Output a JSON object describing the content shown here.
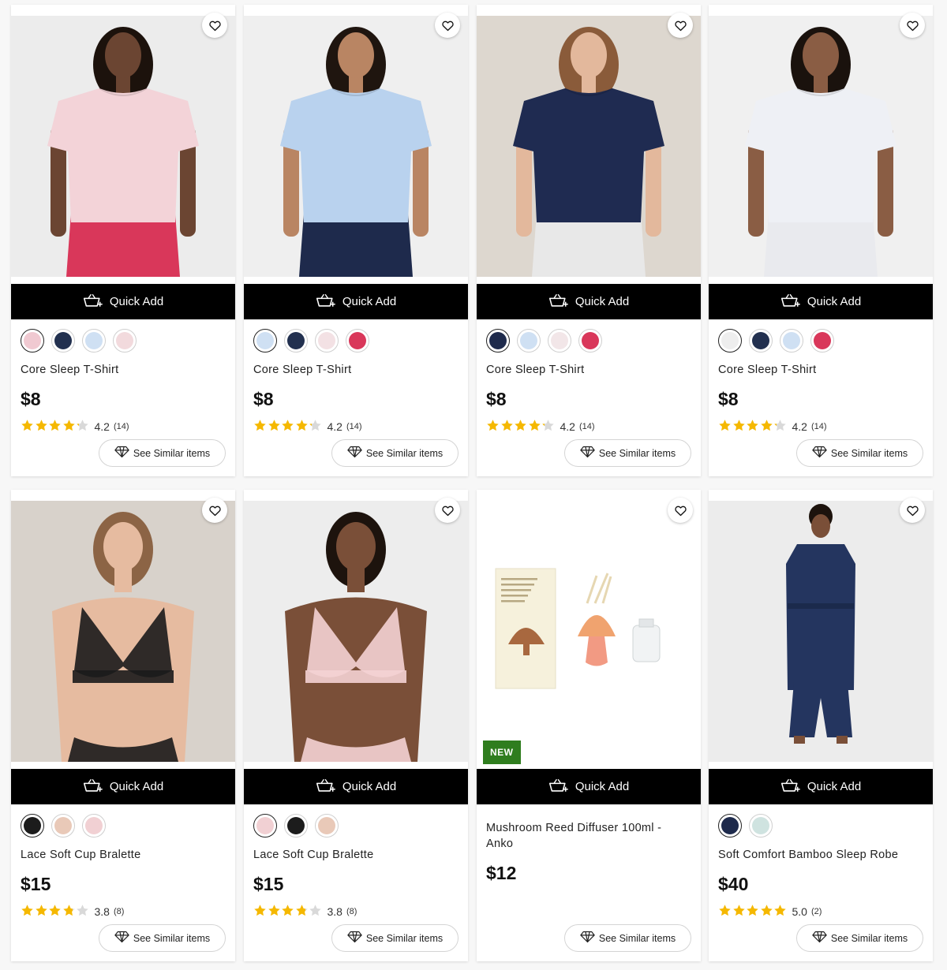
{
  "labels": {
    "quick_add": "Quick Add",
    "see_similar": "See Similar items",
    "new_badge": "NEW"
  },
  "icons": {
    "wishlist": "heart-outline-icon",
    "quick_add": "basket-plus-icon",
    "see_similar": "diamond-icon",
    "star": "star-icon"
  },
  "colors": {
    "star_fill": "#f5b800",
    "star_empty": "#d9d9d9",
    "quick_add_bg": "#000000",
    "new_badge_bg": "#2f7d1e"
  },
  "products": [
    {
      "name": "Core Sleep T-Shirt",
      "price": "$8",
      "rating": 4.2,
      "rating_text": "4.2",
      "reviews": "(14)",
      "swatches": [
        "#f0c9d1",
        "#22304f",
        "#cfe0f3",
        "#f2dadd"
      ],
      "image": {
        "kind": "tee",
        "bg": "#ececec",
        "skin": "#6b4532",
        "hair": "#1c120c",
        "shirt": "#f3d3d8",
        "bottom": "#d9375a"
      }
    },
    {
      "name": "Core Sleep T-Shirt",
      "price": "$8",
      "rating": 4.2,
      "rating_text": "4.2",
      "reviews": "(14)",
      "swatches": [
        "#cfe0f3",
        "#22304f",
        "#f3e1e4",
        "#d9375a"
      ],
      "image": {
        "kind": "tee",
        "bg": "#efefef",
        "skin": "#b98563",
        "hair": "#1f150f",
        "shirt": "#b9d2ee",
        "bottom": "#1e2a4c"
      }
    },
    {
      "name": "Core Sleep T-Shirt",
      "price": "$8",
      "rating": 4.2,
      "rating_text": "4.2",
      "reviews": "(14)",
      "swatches": [
        "#1e2a4c",
        "#cfe0f3",
        "#f2e6e8",
        "#d9375a"
      ],
      "image": {
        "kind": "tee",
        "bg": "#ddd7cf",
        "skin": "#e3b89c",
        "hair": "#8a5b3a",
        "shirt": "#1f2b51",
        "bottom": "#e8e8e8"
      }
    },
    {
      "name": "Core Sleep T-Shirt",
      "price": "$8",
      "rating": 4.2,
      "rating_text": "4.2",
      "reviews": "(14)",
      "swatches": [
        "#eeeeee",
        "#22304f",
        "#cfe0f3",
        "#d9375a"
      ],
      "image": {
        "kind": "tee",
        "bg": "#f0f0f0",
        "skin": "#8a5d44",
        "hair": "#1a120d",
        "shirt": "#eef0f5",
        "bottom": "#e9eaee"
      }
    },
    {
      "name": "Lace Soft Cup Bralette",
      "price": "$15",
      "rating": 3.8,
      "rating_text": "3.8",
      "reviews": "(8)",
      "swatches": [
        "#1c1c1c",
        "#e9c9b8",
        "#f1d0d3"
      ],
      "image": {
        "kind": "bra",
        "bg": "#d8d2cb",
        "skin": "#e6bba0",
        "hair": "#8c6445",
        "shirt": "#1b1b1b",
        "bottom": "#1b1b1b"
      }
    },
    {
      "name": "Lace Soft Cup Bralette",
      "price": "$15",
      "rating": 3.8,
      "rating_text": "3.8",
      "reviews": "(8)",
      "swatches": [
        "#f1d0d3",
        "#1c1c1c",
        "#e9c9b8"
      ],
      "image": {
        "kind": "bra",
        "bg": "#ededed",
        "skin": "#7a4f38",
        "hair": "#1d130d",
        "shirt": "#f4d2d4",
        "bottom": "#f4d2d4"
      }
    },
    {
      "name": "Mushroom Reed Diffuser 100ml - Anko",
      "price": "$12",
      "rating": null,
      "is_new": true,
      "swatches": [],
      "image": {
        "kind": "diffuser",
        "bg": "#ffffff"
      }
    },
    {
      "name": "Soft Comfort Bamboo Sleep Robe",
      "price": "$40",
      "rating": 5.0,
      "rating_text": "5.0",
      "reviews": "(2)",
      "swatches": [
        "#1e2a4c",
        "#cfe3e0"
      ],
      "image": {
        "kind": "robe",
        "bg": "#ececec",
        "skin": "#7a4f38",
        "hair": "#1d130d",
        "shirt": "#24355f",
        "bottom": "#24355f"
      }
    }
  ]
}
